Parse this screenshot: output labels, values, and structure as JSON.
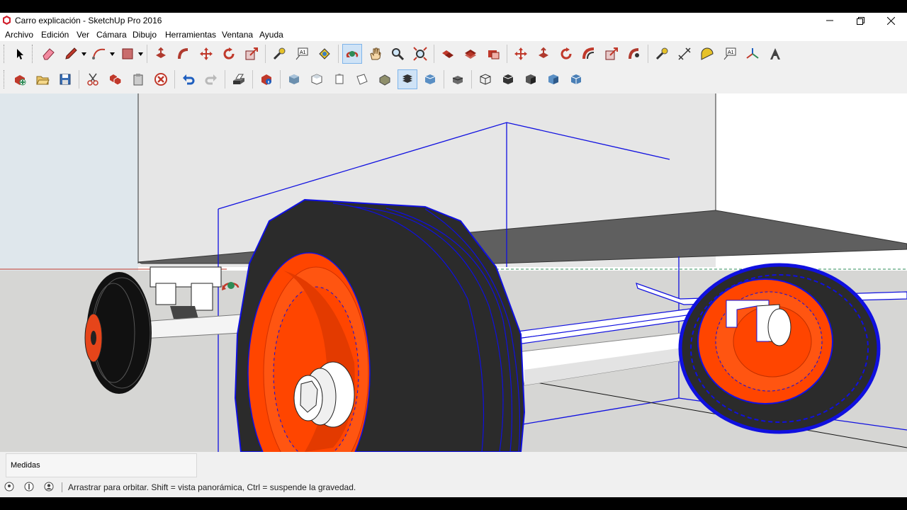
{
  "window": {
    "title": "Carro explicación - SketchUp Pro 2016"
  },
  "menu": [
    "Archivo",
    "Edición",
    "Ver",
    "Cámara",
    "Dibujo",
    "Herramientas",
    "Ventana",
    "Ayuda"
  ],
  "toolbar_icons": {
    "row1": [
      "select-icon",
      "eraser-icon",
      "pencil-line-icon",
      "arc-icon",
      "rectangle-icon",
      "push-pull-icon",
      "follow-me-icon",
      "move-icon",
      "rotate-icon",
      "scale-icon",
      "tape-measure-icon",
      "text-icon",
      "paint-bucket-icon",
      "orbit-icon",
      "pan-icon",
      "zoom-icon",
      "zoom-extents-icon",
      "union-icon",
      "intersect-icon",
      "split-icon",
      "move-icon",
      "push-pull-icon",
      "rotate-icon",
      "offset-icon",
      "scale-icon",
      "follow-me-icon",
      "tape-measure-icon",
      "dimension-icon",
      "protractor-icon",
      "text-icon",
      "axes-icon",
      "3d-text-icon"
    ],
    "row2": [
      "new-icon",
      "open-icon",
      "save-icon",
      "cut-icon",
      "copy-icon",
      "paste-icon",
      "delete-icon",
      "undo-icon",
      "redo-icon",
      "print-icon",
      "model-info-icon",
      "iso-view-icon",
      "top-view-icon",
      "front-view-icon",
      "right-view-icon",
      "back-view-icon",
      "left-view-icon",
      "bottom-view-icon",
      "xray-icon",
      "wireframe-icon",
      "hidden-line-icon",
      "shaded-icon",
      "shaded-textures-icon",
      "monochrome-icon"
    ]
  },
  "colors": {
    "accent_selected": "#1010e0",
    "rim": "#ff4500",
    "tire": "#2b2b2b",
    "body": "#5f5f5f",
    "active_tool": "#cfe3f6"
  },
  "measurements": {
    "label": "Medidas",
    "value": ""
  },
  "status": {
    "text": "Arrastrar para orbitar. Shift = vista panorámica, Ctrl = suspende la gravedad."
  }
}
